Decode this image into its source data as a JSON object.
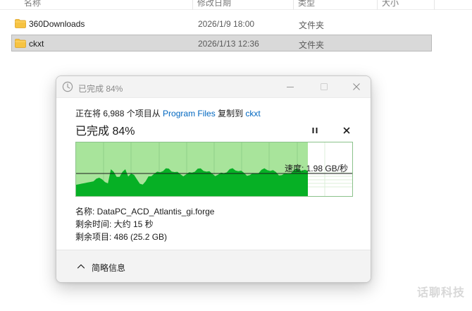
{
  "explorer": {
    "columns": [
      "名称",
      "修改日期",
      "类型",
      "大小"
    ],
    "rows": [
      {
        "name": "360Downloads",
        "date": "2026/1/9 18:00",
        "type": "文件夹",
        "selected": false
      },
      {
        "name": "ckxt",
        "date": "2026/1/13 12:36",
        "type": "文件夹",
        "selected": true
      }
    ],
    "folder_color": "#f6c342"
  },
  "watermark": "话聊科技",
  "dialog": {
    "title": "已完成 84%",
    "copy_prefix": "正在将 6,988 个项目从 ",
    "source": "Program Files",
    "copy_mid": " 复制到 ",
    "destination": "ckxt",
    "heading": "已完成 84%",
    "progress_percent": 84,
    "speed": "速度: 1.98 GB/秒",
    "name_line": "名称: DataPC_ACD_Atlantis_gi.forge",
    "time_line": "剩余时间: 大约 15 秒",
    "items_line": "剩余项目: 486 (25.2 GB)",
    "less_details": "简略信息",
    "icons": {
      "title": "clock-icon",
      "minimize": "minimize-icon",
      "maximize": "maximize-icon",
      "close": "close-icon",
      "pause": "pause-icon",
      "cancel": "cancel-icon",
      "collapse": "chevron-up-icon"
    },
    "colors": {
      "link": "#0067c0",
      "graph_fill": "#06b025",
      "graph_bg": "#a8e49b",
      "graph_grid": "#8fd08a"
    }
  }
}
